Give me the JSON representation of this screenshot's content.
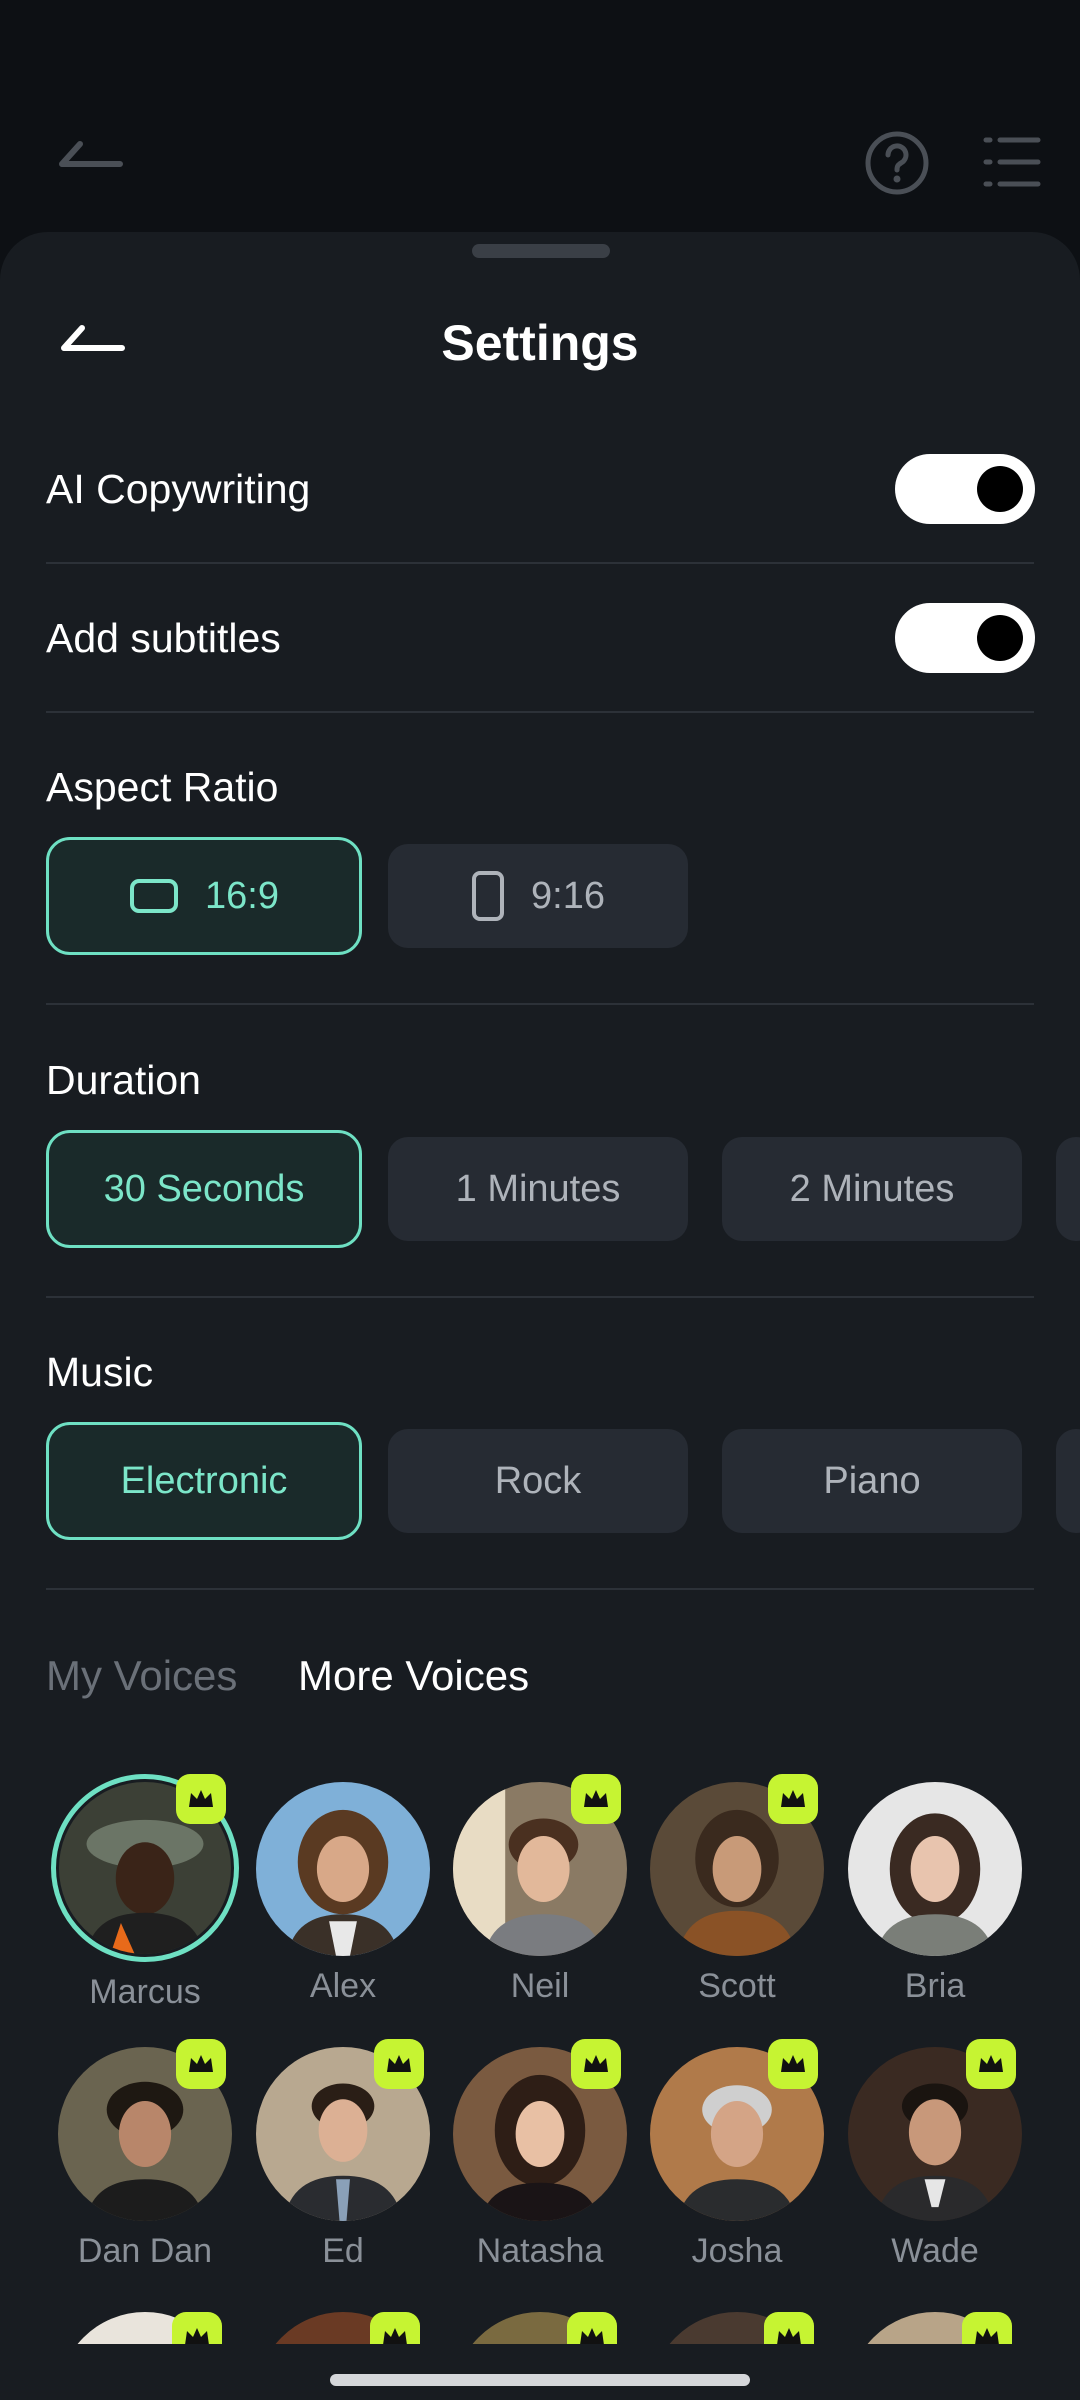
{
  "sheet": {
    "title": "Settings"
  },
  "toggles": [
    {
      "label": "AI Copywriting",
      "on": true
    },
    {
      "label": "Add subtitles",
      "on": true
    }
  ],
  "aspect_ratio": {
    "label": "Aspect Ratio",
    "options": [
      {
        "label": "16:9",
        "icon": "landscape-icon",
        "selected": true
      },
      {
        "label": "9:16",
        "icon": "portrait-icon",
        "selected": false
      }
    ]
  },
  "duration": {
    "label": "Duration",
    "options": [
      {
        "label": "30 Seconds",
        "selected": true
      },
      {
        "label": "1 Minutes",
        "selected": false
      },
      {
        "label": "2 Minutes",
        "selected": false
      }
    ]
  },
  "music": {
    "label": "Music",
    "options": [
      {
        "label": "Electronic",
        "selected": true
      },
      {
        "label": "Rock",
        "selected": false
      },
      {
        "label": "Piano",
        "selected": false
      }
    ]
  },
  "voice_tabs": [
    {
      "label": "My Voices",
      "active": false
    },
    {
      "label": "More Voices",
      "active": true
    }
  ],
  "voices": [
    {
      "name": "Marcus",
      "premium": true,
      "selected": true
    },
    {
      "name": "Alex",
      "premium": false
    },
    {
      "name": "Neil",
      "premium": true
    },
    {
      "name": "Scott",
      "premium": true
    },
    {
      "name": "Bria",
      "premium": false
    },
    {
      "name": "Dan Dan",
      "premium": true
    },
    {
      "name": "Ed",
      "premium": true
    },
    {
      "name": "Natasha",
      "premium": true
    },
    {
      "name": "Josha",
      "premium": true
    },
    {
      "name": "Wade",
      "premium": true
    }
  ],
  "colors": {
    "accent": "#6ee0c3",
    "premium": "#c6f432",
    "sheet_bg": "#181c21",
    "chip_bg": "#262b33"
  }
}
